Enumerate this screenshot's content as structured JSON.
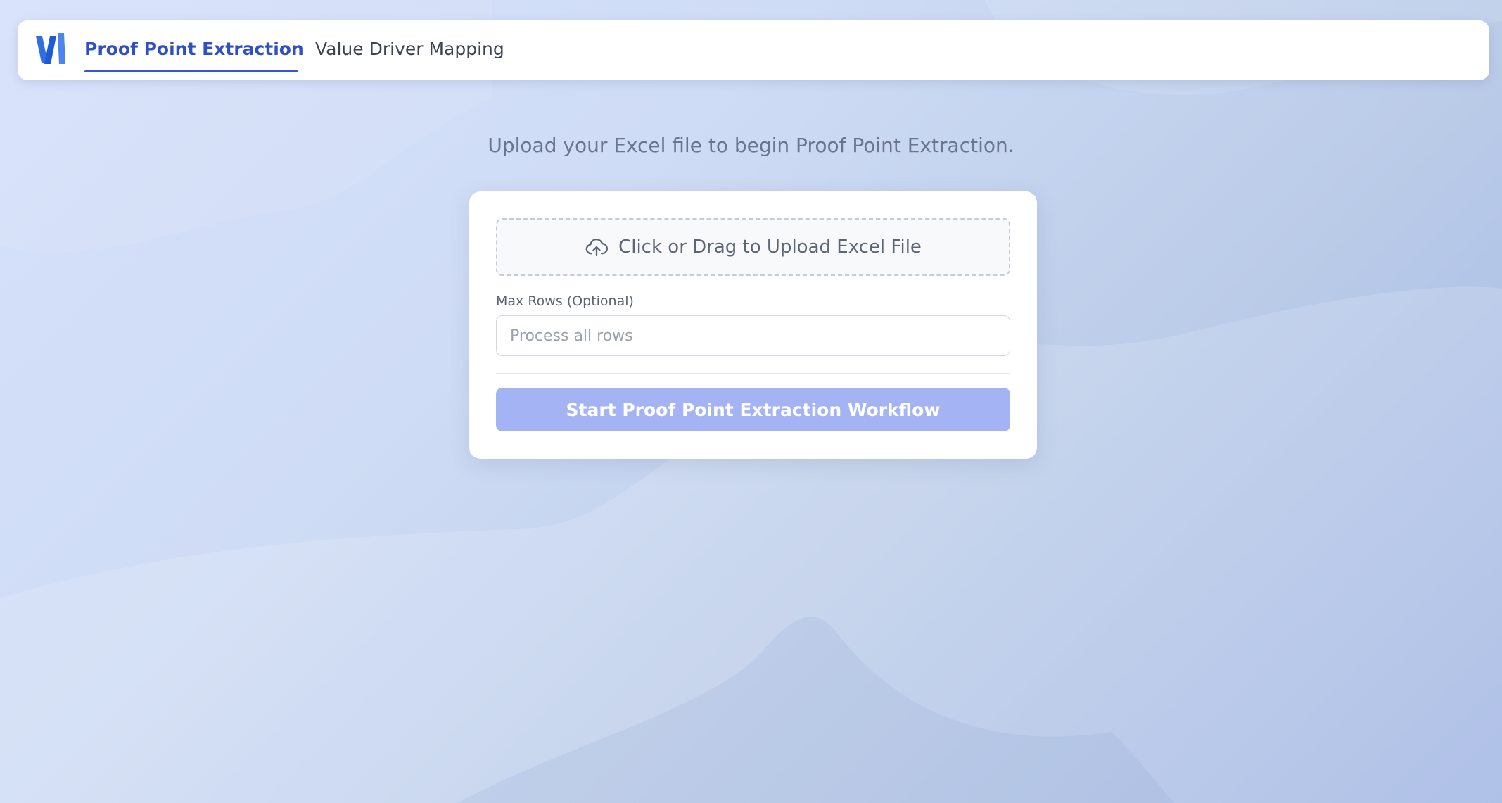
{
  "nav": {
    "logo_icon": "brand-logo-icon",
    "tabs": [
      {
        "label": "Proof Point Extraction",
        "active": true
      },
      {
        "label": "Value Driver Mapping",
        "active": false
      }
    ]
  },
  "main": {
    "intro_text": "Upload your Excel file to begin Proof Point Extraction.",
    "upload": {
      "icon": "cloud-upload-icon",
      "label": "Click or Drag to Upload Excel File"
    },
    "max_rows": {
      "label": "Max Rows (Optional)",
      "value": "",
      "placeholder": "Process all rows"
    },
    "start_button_label": "Start Proof Point Extraction Workflow"
  },
  "colors": {
    "accent": "#2f4fc4",
    "button_bg": "#a4b3f4",
    "background_start": "#d6e1fb",
    "background_end": "#a3b7e4"
  }
}
